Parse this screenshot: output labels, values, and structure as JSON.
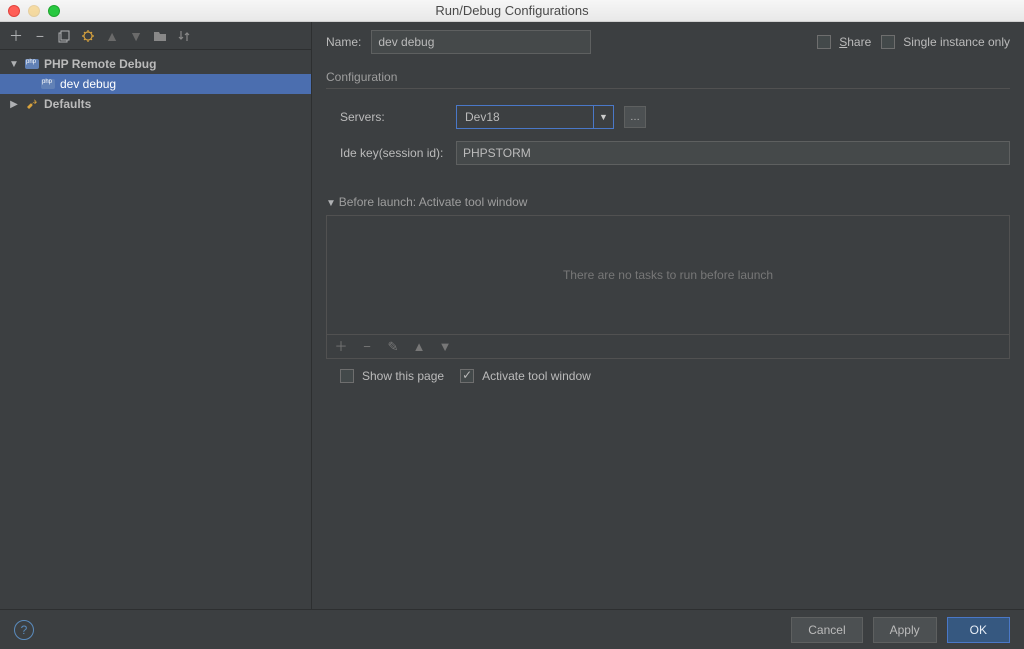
{
  "window": {
    "title": "Run/Debug Configurations"
  },
  "sidebar": {
    "nodes": [
      {
        "label": "PHP Remote Debug",
        "type": "php"
      },
      {
        "label": "dev debug",
        "type": "php-child"
      },
      {
        "label": "Defaults",
        "type": "defaults"
      }
    ]
  },
  "form": {
    "name_label": "Name:",
    "name_value": "dev debug",
    "share_label": "Share",
    "single_instance_label": "Single instance only",
    "configuration_header": "Configuration",
    "servers_label": "Servers:",
    "servers_value": "Dev18",
    "ide_key_label": "Ide key(session id):",
    "ide_key_value": "PHPSTORM",
    "before_launch_header": "Before launch: Activate tool window",
    "no_tasks_text": "There are no tasks to run before launch",
    "show_this_page": "Show this page",
    "activate_tool_window": "Activate tool window"
  },
  "buttons": {
    "cancel": "Cancel",
    "apply": "Apply",
    "ok": "OK"
  }
}
